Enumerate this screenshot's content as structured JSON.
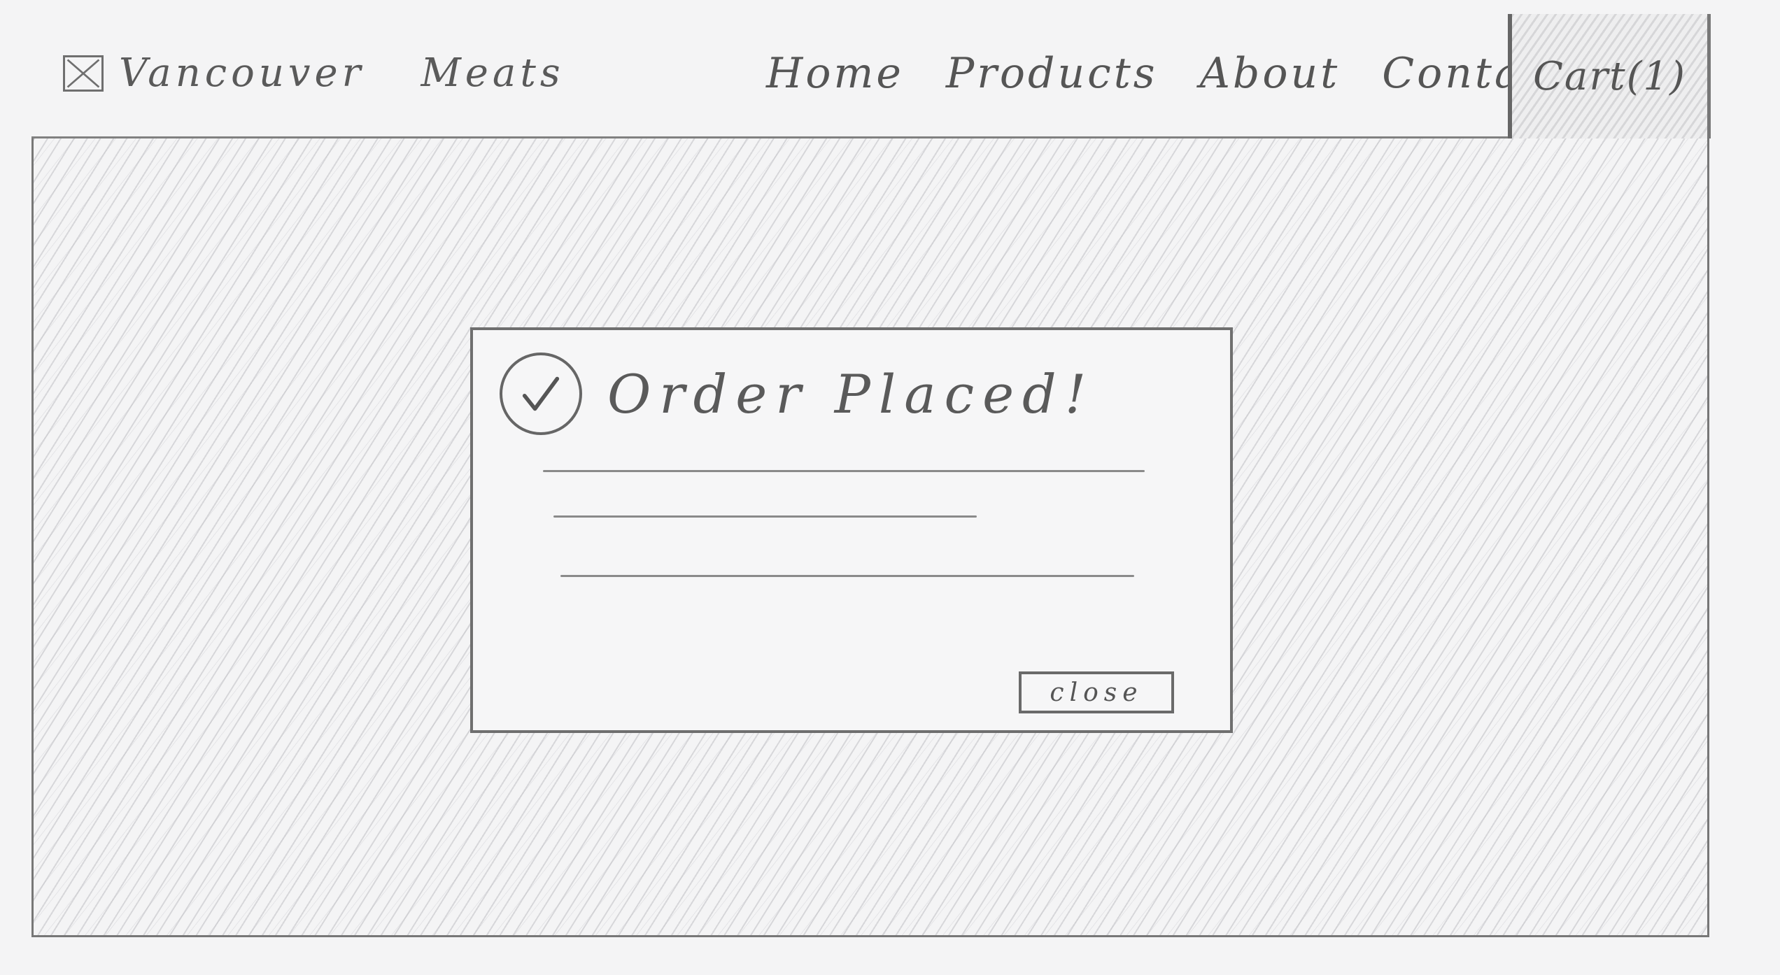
{
  "header": {
    "brand_part1": "Vancouver",
    "brand_part2": "Meats",
    "nav": {
      "home": "Home",
      "products": "Products",
      "about": "About",
      "contact": "Contact"
    },
    "cart_label": "Cart(1)",
    "logo_icon": "image-placeholder-icon"
  },
  "modal": {
    "icon": "check-circle-icon",
    "title": "Order Placed!",
    "close_label": "close"
  }
}
